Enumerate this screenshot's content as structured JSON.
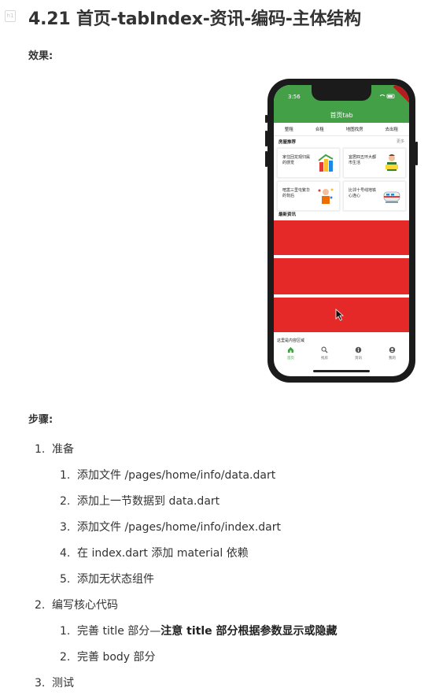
{
  "heading": "4.21 首页-tabIndex-资讯-编码-主体结构",
  "effect_label": "效果:",
  "steps_label": "步骤:",
  "phone": {
    "time": "3:56",
    "appbar_title": "首页tab",
    "tabs": [
      "整租",
      "合租",
      "地图找房",
      "去出租"
    ],
    "section_title": "房屋推荐",
    "section_more": "更多",
    "cards": [
      {
        "text": "家住回龙观归属的感觉"
      },
      {
        "text": "宜居四五环大都市生活"
      },
      {
        "text": "喧嚣三里屯繁华的背后"
      },
      {
        "text": "比邻十号线地铁心连心"
      }
    ],
    "news_title": "最新资讯",
    "content_area": "这里是内容区域",
    "bottom_nav": [
      {
        "label": "首页",
        "icon": "home-icon"
      },
      {
        "label": "找房",
        "icon": "search-icon"
      },
      {
        "label": "资讯",
        "icon": "info-icon"
      },
      {
        "label": "我的",
        "icon": "account-icon"
      }
    ],
    "colors": {
      "primary": "#43a047",
      "news_block": "#e52929"
    }
  },
  "steps": [
    {
      "number": "1.",
      "text": "准备",
      "substeps": [
        {
          "number": "1.",
          "text": "添加文件 /pages/home/info/data.dart"
        },
        {
          "number": "2.",
          "text": "添加上一节数据到 data.dart"
        },
        {
          "number": "3.",
          "text": "添加文件 /pages/home/info/index.dart"
        },
        {
          "number": "4.",
          "text": "在 index.dart 添加 material 依赖"
        },
        {
          "number": "5.",
          "text": "添加无状态组件"
        }
      ]
    },
    {
      "number": "2.",
      "text": "编写核心代码",
      "substeps": [
        {
          "number": "1.",
          "text": "完善 title 部分—",
          "bold": "注意 title 部分根据参数显示或隐藏"
        },
        {
          "number": "2.",
          "text": "完善 body 部分"
        }
      ]
    },
    {
      "number": "3.",
      "text": "测试",
      "substeps": []
    }
  ]
}
